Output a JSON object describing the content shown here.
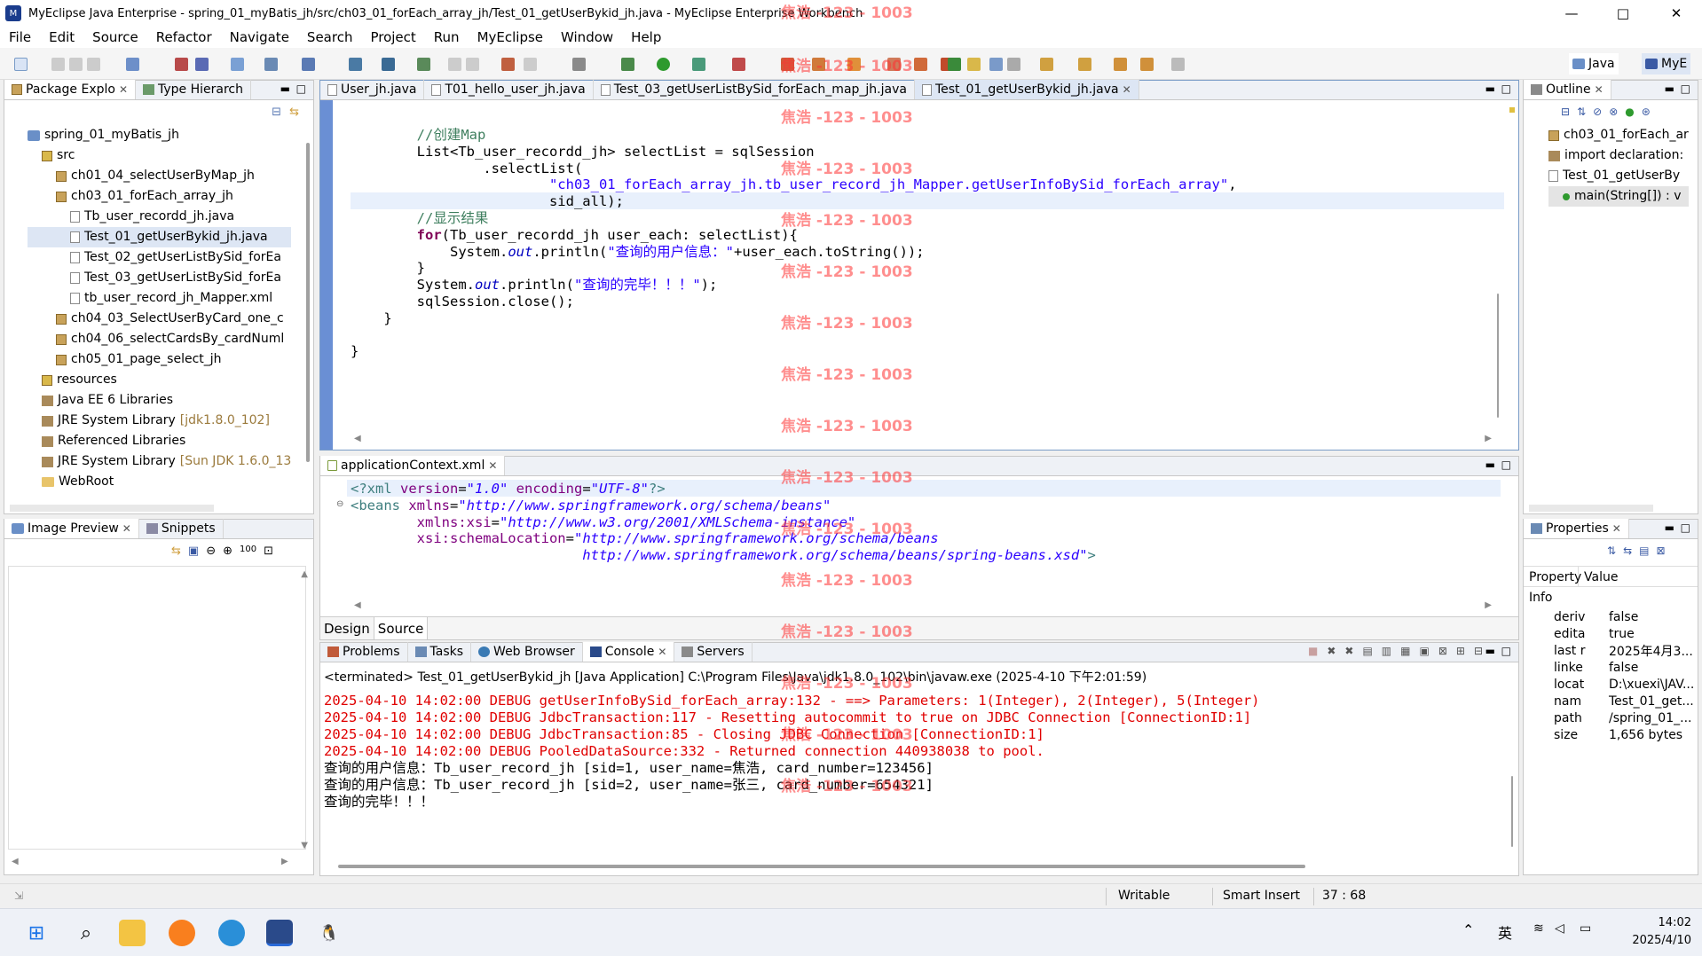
{
  "window": {
    "title": "MyEclipse Java Enterprise - spring_01_myBatis_jh/src/ch03_01_forEach_array_jh/Test_01_getUserBykid_jh.java - MyEclipse Enterprise Workbench",
    "minimize": "—",
    "maximize": "□",
    "close": "✕"
  },
  "menu": [
    "File",
    "Edit",
    "Source",
    "Refactor",
    "Navigate",
    "Search",
    "Project",
    "Run",
    "MyEclipse",
    "Window",
    "Help"
  ],
  "perspectives": {
    "java": "Java",
    "myeclipse": "MyE"
  },
  "package_explorer": {
    "tabs": [
      "Package Explo",
      "Type Hierarch"
    ],
    "tree": [
      {
        "label": "spring_01_myBatis_jh",
        "level": 0,
        "icon": "project-icon"
      },
      {
        "label": "src",
        "level": 1,
        "icon": "source-folder-icon"
      },
      {
        "label": "ch01_04_selectUserByMap_jh",
        "level": 2,
        "icon": "package-icon"
      },
      {
        "label": "ch03_01_forEach_array_jh",
        "level": 2,
        "icon": "package-icon"
      },
      {
        "label": "Tb_user_recordd_jh.java",
        "level": 3,
        "icon": "java-file-icon"
      },
      {
        "label": "Test_01_getUserBykid_jh.java",
        "level": 3,
        "icon": "java-file-icon",
        "selected": true
      },
      {
        "label": "Test_02_getUserListBySid_forEa",
        "level": 3,
        "icon": "java-file-icon"
      },
      {
        "label": "Test_03_getUserListBySid_forEa",
        "level": 3,
        "icon": "java-file-icon"
      },
      {
        "label": "tb_user_record_jh_Mapper.xml",
        "level": 3,
        "icon": "xml-file-icon"
      },
      {
        "label": "ch04_03_SelectUserByCard_one_c",
        "level": 2,
        "icon": "package-icon"
      },
      {
        "label": "ch04_06_selectCardsBy_cardNuml",
        "level": 2,
        "icon": "package-icon"
      },
      {
        "label": "ch05_01_page_select_jh",
        "level": 2,
        "icon": "package-icon"
      },
      {
        "label": "resources",
        "level": 1,
        "icon": "source-folder-icon"
      },
      {
        "label": "Java EE 6 Libraries",
        "level": 1,
        "icon": "library-icon"
      },
      {
        "label": "JRE System Library",
        "suffix": "[jdk1.8.0_102]",
        "level": 1,
        "icon": "library-icon"
      },
      {
        "label": "Referenced Libraries",
        "level": 1,
        "icon": "library-icon"
      },
      {
        "label": "JRE System Library",
        "suffix": "[Sun JDK 1.6.0_13",
        "level": 1,
        "icon": "library-icon"
      },
      {
        "label": "WebRoot",
        "level": 1,
        "icon": "folder-icon"
      }
    ]
  },
  "image_preview": {
    "tabs": [
      "Image Preview",
      "Snippets"
    ]
  },
  "editor": {
    "tabs": [
      "User_jh.java",
      "T01_hello_user_jh.java",
      "Test_03_getUserListBySid_forEach_map_jh.java",
      "Test_01_getUserBykid_jh.java"
    ],
    "lines": [
      {
        "indent": "        ",
        "parts": [
          {
            "t": "//创建Map",
            "c": "cmt"
          }
        ]
      },
      {
        "indent": "        ",
        "parts": [
          {
            "t": "List<Tb_user_recordd_jh> selectList = sqlSession",
            "c": ""
          }
        ]
      },
      {
        "indent": "                ",
        "parts": [
          {
            "t": ".selectList(",
            "c": ""
          }
        ]
      },
      {
        "indent": "                        ",
        "parts": [
          {
            "t": "\"ch03_01_forEach_array_jh.tb_user_record_jh_Mapper.getUserInfoBySid_forEach_array\"",
            "c": "str"
          },
          {
            "t": ",",
            "c": ""
          }
        ],
        "highlight": true
      },
      {
        "indent": "                        ",
        "parts": [
          {
            "t": "sid_all);",
            "c": ""
          }
        ]
      },
      {
        "indent": "        ",
        "parts": [
          {
            "t": "//显示结果",
            "c": "cmt"
          }
        ]
      },
      {
        "indent": "        ",
        "parts": [
          {
            "t": "for",
            "c": "kw"
          },
          {
            "t": "(Tb_user_recordd_jh user_each: selectList){",
            "c": ""
          }
        ]
      },
      {
        "indent": "            ",
        "parts": [
          {
            "t": "System.",
            "c": ""
          },
          {
            "t": "out",
            "c": "fld"
          },
          {
            "t": ".println(",
            "c": ""
          },
          {
            "t": "\"查询的用户信息：\"",
            "c": "str"
          },
          {
            "t": "+user_each.toString());",
            "c": ""
          }
        ]
      },
      {
        "indent": "        ",
        "parts": [
          {
            "t": "}",
            "c": ""
          }
        ]
      },
      {
        "indent": "        ",
        "parts": [
          {
            "t": "System.",
            "c": ""
          },
          {
            "t": "out",
            "c": "fld"
          },
          {
            "t": ".println(",
            "c": ""
          },
          {
            "t": "\"查询的完毕！！！\"",
            "c": "str"
          },
          {
            "t": ");",
            "c": ""
          }
        ]
      },
      {
        "indent": "        ",
        "parts": [
          {
            "t": "sqlSession.close();",
            "c": ""
          }
        ]
      },
      {
        "indent": "    ",
        "parts": [
          {
            "t": "}",
            "c": ""
          }
        ]
      },
      {
        "indent": "",
        "parts": [
          {
            "t": " ",
            "c": ""
          }
        ]
      },
      {
        "indent": "",
        "parts": [
          {
            "t": "}",
            "c": ""
          }
        ]
      }
    ]
  },
  "xml_editor": {
    "tab": "applicationContext.xml",
    "lines": [
      {
        "indent": "",
        "parts": [
          {
            "t": "<?xml ",
            "c": "xtag"
          },
          {
            "t": "version",
            "c": "xattr"
          },
          {
            "t": "=",
            "c": ""
          },
          {
            "t": "\"1.0\"",
            "c": "xval"
          },
          {
            "t": " encoding",
            "c": "xattr"
          },
          {
            "t": "=",
            "c": ""
          },
          {
            "t": "\"UTF-8\"",
            "c": "xval"
          },
          {
            "t": "?>",
            "c": "xtag"
          }
        ]
      },
      {
        "indent": "",
        "parts": [
          {
            "t": "<beans ",
            "c": "xtag"
          },
          {
            "t": "xmlns",
            "c": "xattr"
          },
          {
            "t": "=",
            "c": ""
          },
          {
            "t": "\"http://www.springframework.org/schema/beans\"",
            "c": "xval"
          }
        ]
      },
      {
        "indent": "        ",
        "parts": [
          {
            "t": "xmlns:xsi",
            "c": "xattr"
          },
          {
            "t": "=",
            "c": ""
          },
          {
            "t": "\"http://www.w3.org/2001/XMLSchema-instance\"",
            "c": "xval"
          }
        ]
      },
      {
        "indent": "        ",
        "parts": [
          {
            "t": "xsi:schemaLocation",
            "c": "xattr"
          },
          {
            "t": "=",
            "c": ""
          },
          {
            "t": "\"http://www.springframework.org/schema/beans",
            "c": "xval"
          }
        ]
      },
      {
        "indent": "                            ",
        "parts": [
          {
            "t": "http://www.springframework.org/schema/beans/spring-beans.xsd\"",
            "c": "xval"
          },
          {
            "t": ">",
            "c": "xtag"
          }
        ]
      }
    ],
    "bottom_tabs": [
      "Design",
      "Source"
    ]
  },
  "outline": {
    "tab": "Outline",
    "items": [
      {
        "label": "ch03_01_forEach_ar",
        "icon": "package-icon"
      },
      {
        "label": "import declaration:",
        "icon": "import-icon"
      },
      {
        "label": "Test_01_getUserBy",
        "icon": "class-icon"
      },
      {
        "label": "main(String[]) : v",
        "icon": "method-icon",
        "selected": true
      }
    ]
  },
  "properties": {
    "tab": "Properties",
    "header": {
      "property": "Property",
      "value": "Value"
    },
    "group": "Info",
    "rows": [
      {
        "k": "deriv",
        "v": "false"
      },
      {
        "k": "edita",
        "v": "true"
      },
      {
        "k": "last r",
        "v": "2025年4月3..."
      },
      {
        "k": "linke",
        "v": "false"
      },
      {
        "k": "locat",
        "v": "D:\\xuexi\\JAV..."
      },
      {
        "k": "nam",
        "v": "Test_01_get..."
      },
      {
        "k": "path",
        "v": "/spring_01_..."
      },
      {
        "k": "size",
        "v": "1,656  bytes"
      }
    ]
  },
  "console": {
    "tabs": [
      "Problems",
      "Tasks",
      "Web Browser",
      "Console",
      "Servers"
    ],
    "header": "<terminated> Test_01_getUserBykid_jh [Java Application] C:\\Program Files\\Java\\jdk1.8.0_102\\bin\\javaw.exe (2025-4-10 下午2:01:59)",
    "lines": [
      {
        "t": "2025-04-10 14:02:00 DEBUG getUserInfoBySid_forEach_array:132 - ==> Parameters: 1(Integer), 2(Integer), 5(Integer)",
        "c": "dbg"
      },
      {
        "t": "2025-04-10 14:02:00 DEBUG JdbcTransaction:117 - Resetting autocommit to true on JDBC Connection [ConnectionID:1]",
        "c": "dbg"
      },
      {
        "t": "2025-04-10 14:02:00 DEBUG JdbcTransaction:85 - Closing JDBC Connection [ConnectionID:1]",
        "c": "dbg"
      },
      {
        "t": "2025-04-10 14:02:00 DEBUG PooledDataSource:332 - Returned connection 440938038 to pool.",
        "c": "dbg"
      },
      {
        "t": "查询的用户信息：Tb_user_record_jh [sid=1, user_name=焦浩, card_number=123456]",
        "c": ""
      },
      {
        "t": "查询的用户信息：Tb_user_record_jh [sid=2, user_name=张三, card_number=654321]",
        "c": ""
      },
      {
        "t": "查询的完毕！！！",
        "c": ""
      }
    ]
  },
  "status": {
    "writable": "Writable",
    "insert_mode": "Smart Insert",
    "position": "37 : 68"
  },
  "watermark": "焦浩 -123 - 1003",
  "taskbar": {
    "ime": "英",
    "time": "14:02",
    "date": "2025/4/10"
  }
}
